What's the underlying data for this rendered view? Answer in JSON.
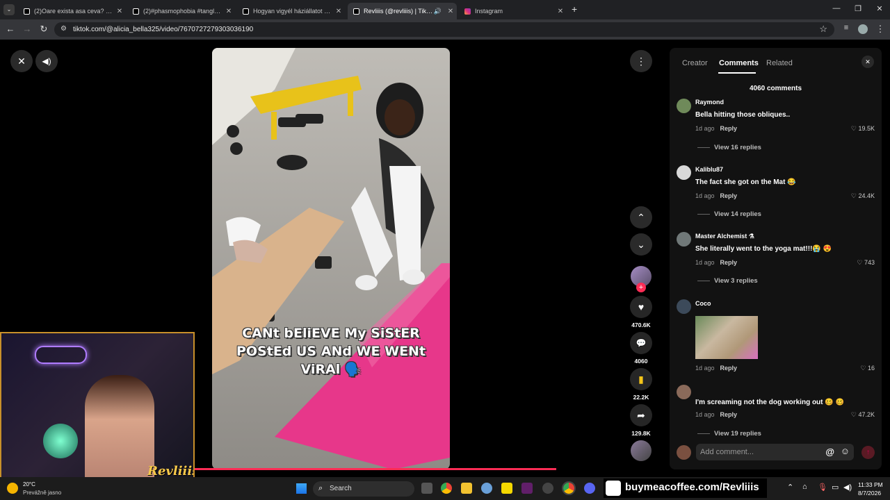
{
  "browser": {
    "tabs": [
      {
        "label": "(2)Oare exista asa ceva? 😱😱😱",
        "icon": "tiktok-icon"
      },
      {
        "label": "(2)#phasmophobia #tanglewood",
        "icon": "tiktok-icon"
      },
      {
        "label": "Hogyan vigyél háziállatot buli b",
        "icon": "tiktok-icon"
      },
      {
        "label": "Revliiis (@revliiis) | TikTok",
        "icon": "tiktok-icon"
      },
      {
        "label": "Instagram",
        "icon": "instagram-icon"
      }
    ],
    "new_tab": "+",
    "url": "tiktok.com/@alicia_bella325/video/7670727279303036190"
  },
  "video": {
    "caption": "CANt bEliEVE My SiStER POStEd US ANd WE WENt ViRAl 🗣️",
    "likes": "470.6K",
    "comments": "4060",
    "saves": "22.2K",
    "shares": "129.8K"
  },
  "panel": {
    "tabs": [
      "Creator",
      "Comments",
      "Related"
    ],
    "active_tab": "Comments",
    "count_label": "4060 comments",
    "comments": [
      {
        "user": "Raymond",
        "text": "Bella hitting those obliques..",
        "time": "1d ago",
        "reply": "Reply",
        "likes": "19.5K",
        "replies": "View 16 replies"
      },
      {
        "user": "Kaliblu87",
        "text": "The fact she got on the Mat 😂",
        "time": "1d ago",
        "reply": "Reply",
        "likes": "24.4K",
        "replies": "View 14 replies"
      },
      {
        "user": "Master Alchemist ⚗",
        "text": "She literally went to the yoga mat!!!😭 😍",
        "time": "1d ago",
        "reply": "Reply",
        "likes": "743",
        "replies": "View 3 replies"
      },
      {
        "user": "Coco",
        "text": "",
        "time": "1d ago",
        "reply": "Reply",
        "likes": "16",
        "replies": ""
      },
      {
        "user": "",
        "text": "I'm screaming not the dog working out 🥴 🥴",
        "time": "1d ago",
        "reply": "Reply",
        "likes": "47.2K",
        "replies": "View 19 replies"
      }
    ],
    "add_comment_placeholder": "Add comment..."
  },
  "overlay": {
    "streamer": "Revliiis",
    "coffee": "buymeacoffee.com/Revliiis"
  },
  "taskbar": {
    "weather_temp": "20°C",
    "weather_desc": "Prevážně jasno",
    "search": "Search",
    "time": "11:33 PM",
    "date": "8/7/2026"
  }
}
